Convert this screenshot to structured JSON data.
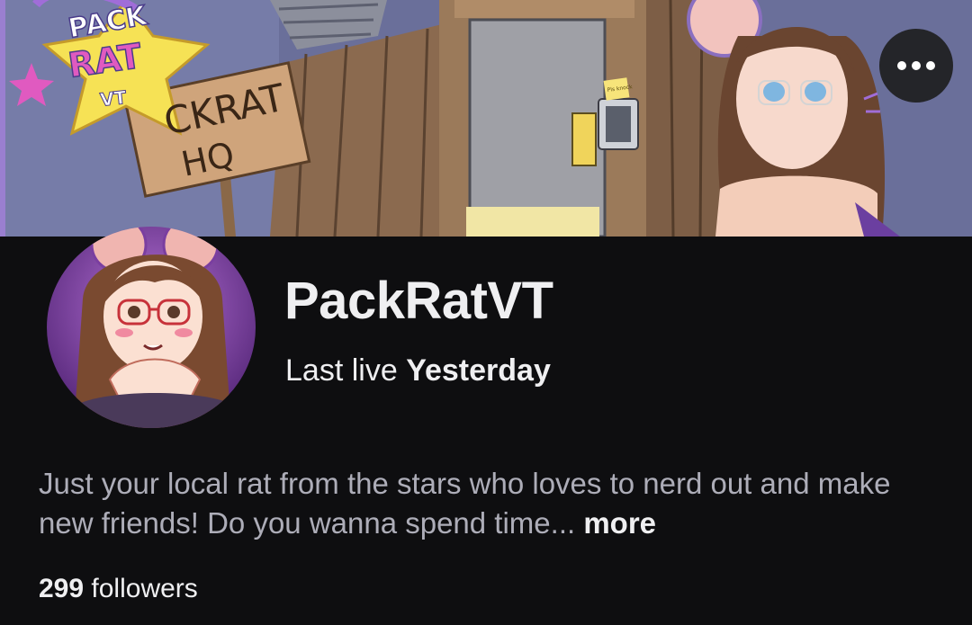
{
  "banner": {
    "logo_line1": "PACK",
    "logo_line2": "RAT",
    "logo_line3": "VT",
    "sign_line1": "CKRAT",
    "sign_line2": "HQ",
    "note_text": "Pls knock"
  },
  "channel": {
    "name": "PackRatVT",
    "last_live_label": "Last live",
    "last_live_value": "Yesterday",
    "bio_text": "Just your local rat from the stars who loves to nerd out and make new friends! Do you wanna spend time...",
    "bio_more": "more",
    "followers_count": "299",
    "followers_label": "followers"
  },
  "colors": {
    "background": "#0e0e10",
    "primary_text": "#efeff1",
    "secondary_text": "#adadb8"
  },
  "icons": {
    "more_options": "more-horizontal-icon"
  }
}
